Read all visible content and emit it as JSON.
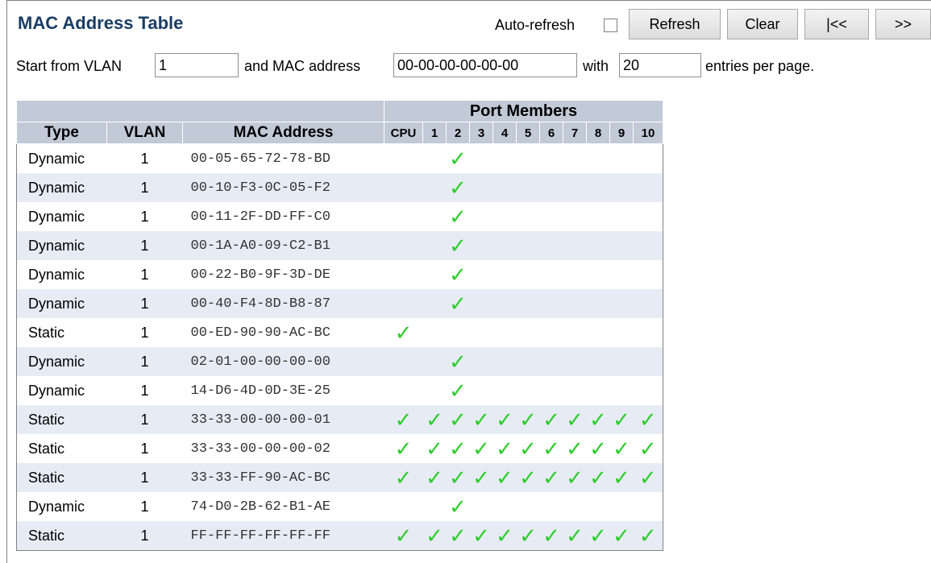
{
  "header": {
    "title": "MAC Address Table",
    "auto_refresh_label": "Auto-refresh",
    "auto_refresh_checked": false,
    "buttons": {
      "refresh": "Refresh",
      "clear": "Clear",
      "first": "|<<",
      "next": ">>"
    }
  },
  "filter": {
    "start_vlan_label": "Start from VLAN",
    "start_vlan_value": "1",
    "mac_label": "and MAC address",
    "mac_value": "00-00-00-00-00-00",
    "with_label": "with",
    "entries_value": "20",
    "entries_label": "entries per page."
  },
  "table": {
    "group_header": "Port Members",
    "columns": [
      "Type",
      "VLAN",
      "MAC Address"
    ],
    "ports": [
      "CPU",
      "1",
      "2",
      "3",
      "4",
      "5",
      "6",
      "7",
      "8",
      "9",
      "10"
    ],
    "check_glyph": "✓",
    "check_color": "#2ecc2e",
    "rows": [
      {
        "type": "Dynamic",
        "vlan": "1",
        "mac": "00-05-65-72-78-BD",
        "members": [
          "2"
        ]
      },
      {
        "type": "Dynamic",
        "vlan": "1",
        "mac": "00-10-F3-0C-05-F2",
        "members": [
          "2"
        ]
      },
      {
        "type": "Dynamic",
        "vlan": "1",
        "mac": "00-11-2F-DD-FF-C0",
        "members": [
          "2"
        ]
      },
      {
        "type": "Dynamic",
        "vlan": "1",
        "mac": "00-1A-A0-09-C2-B1",
        "members": [
          "2"
        ]
      },
      {
        "type": "Dynamic",
        "vlan": "1",
        "mac": "00-22-B0-9F-3D-DE",
        "members": [
          "2"
        ]
      },
      {
        "type": "Dynamic",
        "vlan": "1",
        "mac": "00-40-F4-8D-B8-87",
        "members": [
          "2"
        ]
      },
      {
        "type": "Static",
        "vlan": "1",
        "mac": "00-ED-90-90-AC-BC",
        "members": [
          "CPU"
        ]
      },
      {
        "type": "Dynamic",
        "vlan": "1",
        "mac": "02-01-00-00-00-00",
        "members": [
          "2"
        ]
      },
      {
        "type": "Dynamic",
        "vlan": "1",
        "mac": "14-D6-4D-0D-3E-25",
        "members": [
          "2"
        ]
      },
      {
        "type": "Static",
        "vlan": "1",
        "mac": "33-33-00-00-00-01",
        "members": [
          "CPU",
          "1",
          "2",
          "3",
          "4",
          "5",
          "6",
          "7",
          "8",
          "9",
          "10"
        ]
      },
      {
        "type": "Static",
        "vlan": "1",
        "mac": "33-33-00-00-00-02",
        "members": [
          "CPU",
          "1",
          "2",
          "3",
          "4",
          "5",
          "6",
          "7",
          "8",
          "9",
          "10"
        ]
      },
      {
        "type": "Static",
        "vlan": "1",
        "mac": "33-33-FF-90-AC-BC",
        "members": [
          "CPU",
          "1",
          "2",
          "3",
          "4",
          "5",
          "6",
          "7",
          "8",
          "9",
          "10"
        ]
      },
      {
        "type": "Dynamic",
        "vlan": "1",
        "mac": "74-D0-2B-62-B1-AE",
        "members": [
          "2"
        ]
      },
      {
        "type": "Static",
        "vlan": "1",
        "mac": "FF-FF-FF-FF-FF-FF",
        "members": [
          "CPU",
          "1",
          "2",
          "3",
          "4",
          "5",
          "6",
          "7",
          "8",
          "9",
          "10"
        ]
      }
    ]
  }
}
